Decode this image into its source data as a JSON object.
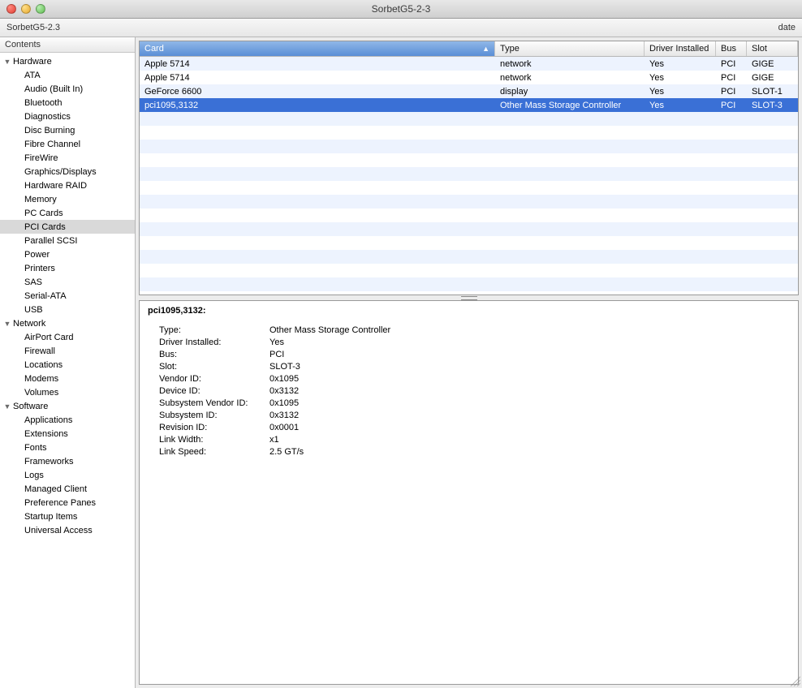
{
  "window": {
    "title": "SorbetG5-2-3",
    "subtitle_left": "SorbetG5-2.3",
    "subtitle_right": "date"
  },
  "sidebar": {
    "header": "Contents",
    "groups": [
      {
        "label": "Hardware",
        "items": [
          "ATA",
          "Audio (Built In)",
          "Bluetooth",
          "Diagnostics",
          "Disc Burning",
          "Fibre Channel",
          "FireWire",
          "Graphics/Displays",
          "Hardware RAID",
          "Memory",
          "PC Cards",
          "PCI Cards",
          "Parallel SCSI",
          "Power",
          "Printers",
          "SAS",
          "Serial-ATA",
          "USB"
        ],
        "selected": "PCI Cards"
      },
      {
        "label": "Network",
        "items": [
          "AirPort Card",
          "Firewall",
          "Locations",
          "Modems",
          "Volumes"
        ]
      },
      {
        "label": "Software",
        "items": [
          "Applications",
          "Extensions",
          "Fonts",
          "Frameworks",
          "Logs",
          "Managed Client",
          "Preference Panes",
          "Startup Items",
          "Universal Access"
        ]
      }
    ]
  },
  "table": {
    "columns": [
      {
        "key": "card",
        "label": "Card",
        "sorted": true
      },
      {
        "key": "type",
        "label": "Type"
      },
      {
        "key": "drv",
        "label": "Driver Installed"
      },
      {
        "key": "bus",
        "label": "Bus"
      },
      {
        "key": "slot",
        "label": "Slot"
      }
    ],
    "rows": [
      {
        "card": "Apple 5714",
        "type": "network",
        "drv": "Yes",
        "bus": "PCI",
        "slot": "GIGE"
      },
      {
        "card": "Apple 5714",
        "type": "network",
        "drv": "Yes",
        "bus": "PCI",
        "slot": "GIGE"
      },
      {
        "card": "GeForce 6600",
        "type": "display",
        "drv": "Yes",
        "bus": "PCI",
        "slot": "SLOT-1"
      },
      {
        "card": "pci1095,3132",
        "type": "Other Mass Storage Controller",
        "drv": "Yes",
        "bus": "PCI",
        "slot": "SLOT-3"
      }
    ],
    "selected_index": 3,
    "blank_rows": 13
  },
  "detail": {
    "heading": "pci1095,3132:",
    "pairs": [
      {
        "k": "Type:",
        "v": "Other Mass Storage Controller"
      },
      {
        "k": "Driver Installed:",
        "v": "Yes"
      },
      {
        "k": "Bus:",
        "v": "PCI"
      },
      {
        "k": "Slot:",
        "v": "SLOT-3"
      },
      {
        "k": "Vendor ID:",
        "v": "0x1095"
      },
      {
        "k": "Device ID:",
        "v": "0x3132"
      },
      {
        "k": "Subsystem Vendor ID:",
        "v": "0x1095"
      },
      {
        "k": "Subsystem ID:",
        "v": "0x3132"
      },
      {
        "k": "Revision ID:",
        "v": "0x0001"
      },
      {
        "k": "Link Width:",
        "v": "x1"
      },
      {
        "k": "Link Speed:",
        "v": "2.5 GT/s"
      }
    ]
  }
}
